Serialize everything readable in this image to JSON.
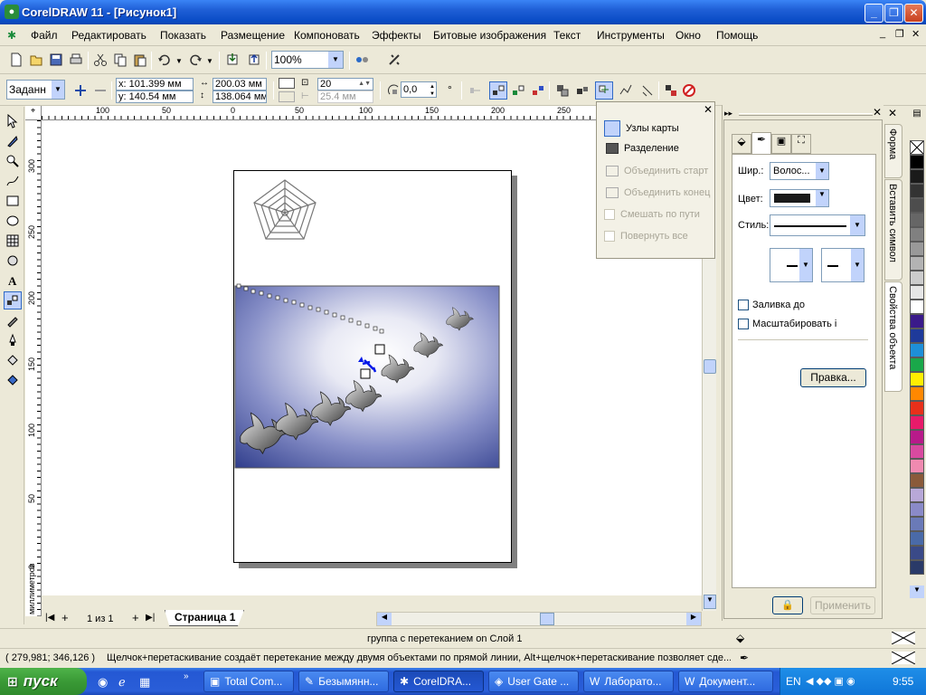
{
  "window": {
    "title": "CorelDRAW 11 - [Рисунок1]"
  },
  "menu": [
    "Файл",
    "Редактировать",
    "Показать",
    "Размещение",
    "Компоновать",
    "Эффекты",
    "Битовые изображения",
    "Текст",
    "Инструменты",
    "Окно",
    "Помощь"
  ],
  "toolbar": {
    "zoom": "100%"
  },
  "propbar": {
    "preset": "Заданн",
    "x": "x: 101.399 мм",
    "y": "y: 140.54 мм",
    "width": "200.03 мм",
    "height": "138.064 мм",
    "steps": "20",
    "offset": "25.4 мм",
    "rotation": "0,0",
    "degree": "°"
  },
  "ruler": {
    "top": [
      "100",
      "50",
      "0",
      "50",
      "100",
      "150",
      "200",
      "250"
    ],
    "left": [
      "300",
      "250",
      "200",
      "150",
      "100",
      "50",
      "0"
    ],
    "units": "миллиметров"
  },
  "popup": {
    "items": [
      {
        "label": "Узлы карты",
        "enabled": true
      },
      {
        "label": "Разделение",
        "enabled": true
      },
      {
        "label": "Объединить старт",
        "enabled": false
      },
      {
        "label": "Объединить конец",
        "enabled": false
      }
    ],
    "checks": [
      {
        "label": "Смешать по пути",
        "enabled": false
      },
      {
        "label": "Повернуть все",
        "enabled": false
      }
    ]
  },
  "docker": {
    "width_label": "Шир.:",
    "width_value": "Волос...",
    "color_label": "Цвет:",
    "style_label": "Стиль:",
    "fill_check": "Заливка до",
    "scale_check": "Масштабировать і",
    "edit_button": "Правка...",
    "apply_button": "Применить"
  },
  "docker_tabs": [
    "Форма",
    "Вставить символ",
    "Свойства объекта"
  ],
  "palette_colors": [
    "#ffffff",
    "#000000",
    "#1a1a1a",
    "#333333",
    "#4d4d4d",
    "#666666",
    "#808080",
    "#999999",
    "#b3b3b3",
    "#cccccc",
    "#e6e6e6",
    "#ffffff",
    "#3a1a8a",
    "#1e3a9a",
    "#1e8fd8",
    "#1aa84a",
    "#ffee00",
    "#ff8800",
    "#e8301a",
    "#e81a6a",
    "#b81a8a",
    "#d84aa0",
    "#f08ab0",
    "#8a5a3a",
    "#b8a8d8",
    "#8a8ac8",
    "#6a7ab8",
    "#4a6aa8",
    "#3a4a88",
    "#2a3a68"
  ],
  "pagebar": {
    "page_count": "1 из 1",
    "page_tab": "Страница 1"
  },
  "status": {
    "object": "группа с перетеканием on Слой 1",
    "coords": "( 279,981; 346,126 )",
    "hint": "Щелчок+перетаскивание создаёт перетекание между двумя объектами по прямой линии, Alt+щелчок+перетаскивание позволяет сде..."
  },
  "taskbar": {
    "start": "пуск",
    "tasks": [
      "Total Com...",
      "Безымянн...",
      "CorelDRA...",
      "User Gate ...",
      "Лаборато...",
      "Документ..."
    ],
    "lang": "EN",
    "time": "9:55"
  }
}
